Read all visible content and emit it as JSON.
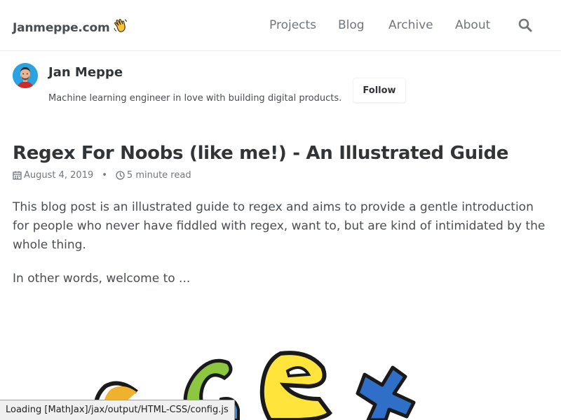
{
  "header": {
    "site_title": "Janmeppe.com",
    "nav": [
      "Projects",
      "Blog",
      "Archive",
      "About"
    ]
  },
  "author": {
    "name": "Jan Meppe",
    "bio": "Machine learning engineer in love with building digital products.",
    "follow_label": "Follow"
  },
  "post": {
    "title": "Regex For Noobs (like me!) - An Illustrated Guide",
    "date": "August 4, 2019",
    "read_time": "5 minute read",
    "paragraphs": [
      "This blog post is an illustrated guide to regex and aims to provide a gentle introduction for people who never have fiddled with regex, want to, but are kind of intimidated by the whole thing.",
      "In other words, welcome to ..."
    ]
  },
  "status_bar": {
    "text": "Loading [MathJax]/jax/output/HTML-CSS/config.js"
  },
  "colors": {
    "text": "#494e52",
    "heading": "#313538",
    "muted": "#6f777d",
    "border": "#eaeaea"
  },
  "icons": [
    "waving-hand-icon",
    "search-icon",
    "calendar-icon",
    "clock-icon"
  ]
}
